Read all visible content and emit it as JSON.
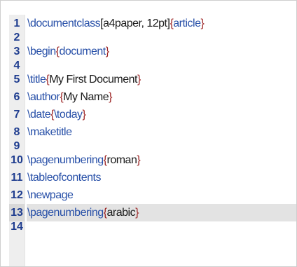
{
  "editor": {
    "lines": [
      {
        "number": "1",
        "cmd": "\\documentclass",
        "pre": "[a4paper, 12pt]",
        "open": "{",
        "arg": "article",
        "close": "}",
        "highlight": false
      },
      {
        "number": "2",
        "cmd": "",
        "pre": "",
        "open": "",
        "arg": "",
        "close": "",
        "highlight": false
      },
      {
        "number": "3",
        "cmd": "\\begin",
        "pre": "",
        "open": "{",
        "arg": "document",
        "close": "}",
        "highlight": false
      },
      {
        "number": "4",
        "cmd": "",
        "pre": "",
        "open": "",
        "arg": "",
        "close": "",
        "highlight": false
      },
      {
        "number": "5",
        "cmd": "\\title",
        "pre": "",
        "open": "{",
        "arg": "My First Document",
        "close": "}",
        "highlight": false
      },
      {
        "number": "6",
        "cmd": "\\author",
        "pre": "",
        "open": "{",
        "arg": "My Name",
        "close": "}",
        "highlight": false
      },
      {
        "number": "7",
        "cmd": "\\date",
        "pre": "",
        "open": "{",
        "arg": "\\today",
        "close": "}",
        "highlight": false
      },
      {
        "number": "8",
        "cmd": "\\maketitle",
        "pre": "",
        "open": "",
        "arg": "",
        "close": "",
        "highlight": false
      },
      {
        "number": "9",
        "cmd": "",
        "pre": "",
        "open": "",
        "arg": "",
        "close": "",
        "highlight": false
      },
      {
        "number": "10",
        "cmd": "\\pagenumbering",
        "pre": "",
        "open": "{",
        "arg": "roman",
        "close": "}",
        "highlight": false
      },
      {
        "number": "11",
        "cmd": "\\tableofcontents",
        "pre": "",
        "open": "",
        "arg": "",
        "close": "",
        "highlight": false
      },
      {
        "number": "12",
        "cmd": "\\newpage",
        "pre": "",
        "open": "",
        "arg": "",
        "close": "",
        "highlight": false
      },
      {
        "number": "13",
        "cmd": "\\pagenumbering",
        "pre": "",
        "open": "{",
        "arg": "arabic",
        "close": "}",
        "highlight": true
      },
      {
        "number": "14",
        "cmd": "",
        "pre": "",
        "open": "",
        "arg": "",
        "close": "",
        "highlight": false
      }
    ]
  }
}
